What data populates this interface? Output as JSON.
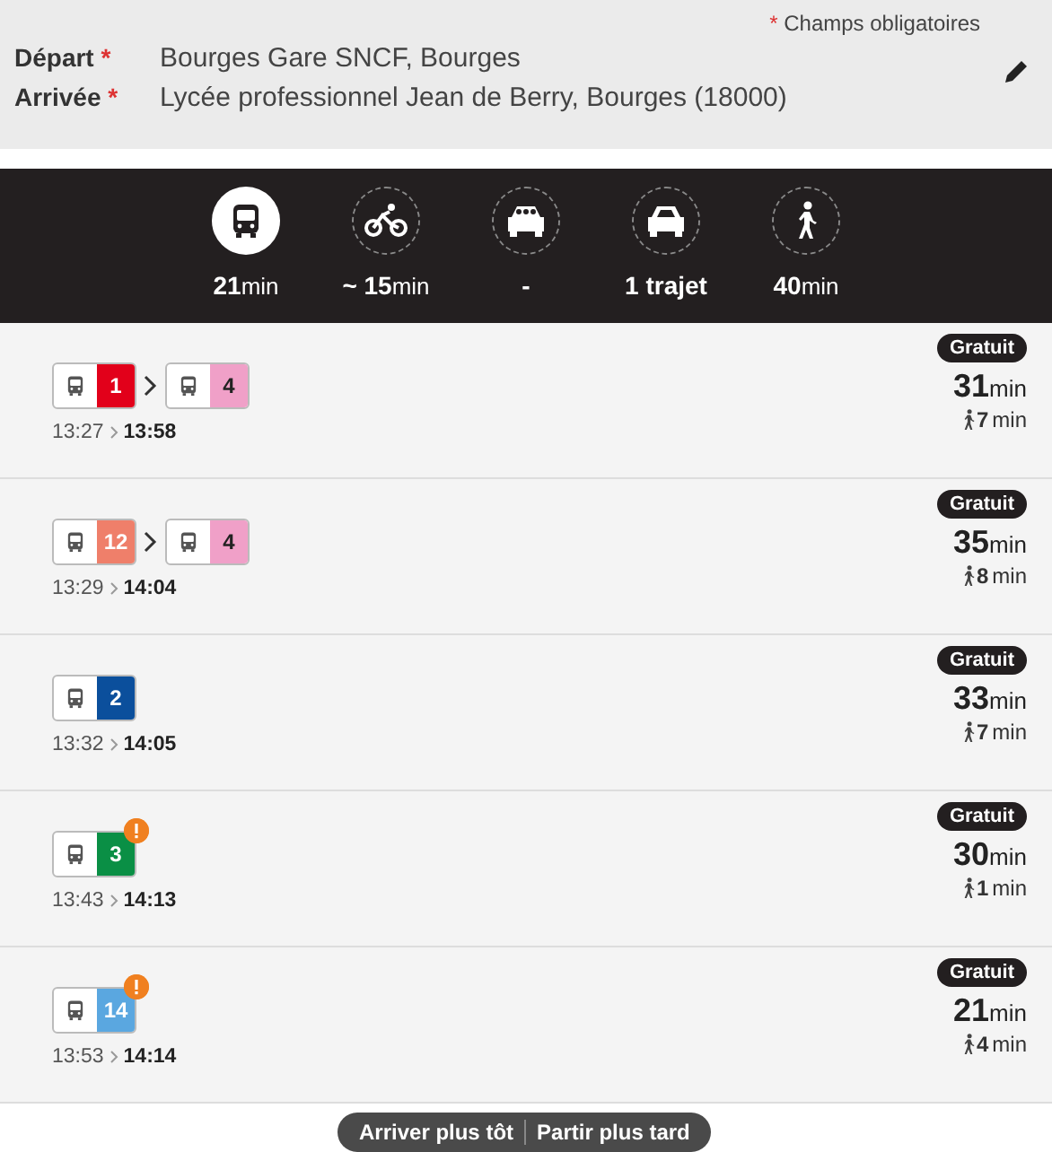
{
  "header": {
    "required_mark": "*",
    "required_note": "Champs obligatoires",
    "fields": [
      {
        "label": "Départ",
        "required_mark": "*",
        "value": "Bourges Gare SNCF, Bourges"
      },
      {
        "label": "Arrivée",
        "required_mark": "*",
        "value": "Lycée professionnel Jean de Berry, Bourges (18000)"
      }
    ]
  },
  "modes": [
    {
      "kind": "bus",
      "value": "21",
      "unit": "min",
      "selected": true
    },
    {
      "kind": "bike",
      "value": "~ 15",
      "unit": "min",
      "selected": false
    },
    {
      "kind": "carpool",
      "value": "-",
      "selected": false
    },
    {
      "kind": "car",
      "value": "1 trajet",
      "selected": false
    },
    {
      "kind": "walk",
      "value": "40",
      "unit": "min",
      "selected": false
    }
  ],
  "routes": [
    {
      "legs": [
        {
          "line": "1",
          "color": "#e2001a",
          "warning": false
        },
        {
          "line": "4",
          "color": "#f0a0c8",
          "warning": false
        }
      ],
      "depart": "13:27",
      "arrive": "13:58",
      "price": "Gratuit",
      "duration": "31",
      "duration_unit": "min",
      "walk": "7",
      "walk_unit": "min"
    },
    {
      "legs": [
        {
          "line": "12",
          "color": "#ef7f6a",
          "warning": false
        },
        {
          "line": "4",
          "color": "#f0a0c8",
          "warning": false
        }
      ],
      "depart": "13:29",
      "arrive": "14:04",
      "price": "Gratuit",
      "duration": "35",
      "duration_unit": "min",
      "walk": "8",
      "walk_unit": "min"
    },
    {
      "legs": [
        {
          "line": "2",
          "color": "#0b4f9c",
          "warning": false
        }
      ],
      "depart": "13:32",
      "arrive": "14:05",
      "price": "Gratuit",
      "duration": "33",
      "duration_unit": "min",
      "walk": "7",
      "walk_unit": "min"
    },
    {
      "legs": [
        {
          "line": "3",
          "color": "#0a8f45",
          "warning": true
        }
      ],
      "depart": "13:43",
      "arrive": "14:13",
      "price": "Gratuit",
      "duration": "30",
      "duration_unit": "min",
      "walk": "1",
      "walk_unit": "min"
    },
    {
      "legs": [
        {
          "line": "14",
          "color": "#5aa7e0",
          "warning": true
        }
      ],
      "depart": "13:53",
      "arrive": "14:14",
      "price": "Gratuit",
      "duration": "21",
      "duration_unit": "min",
      "walk": "4",
      "walk_unit": "min"
    }
  ],
  "footer_buttons": [
    "Arriver plus tôt",
    "Partir plus tard"
  ]
}
